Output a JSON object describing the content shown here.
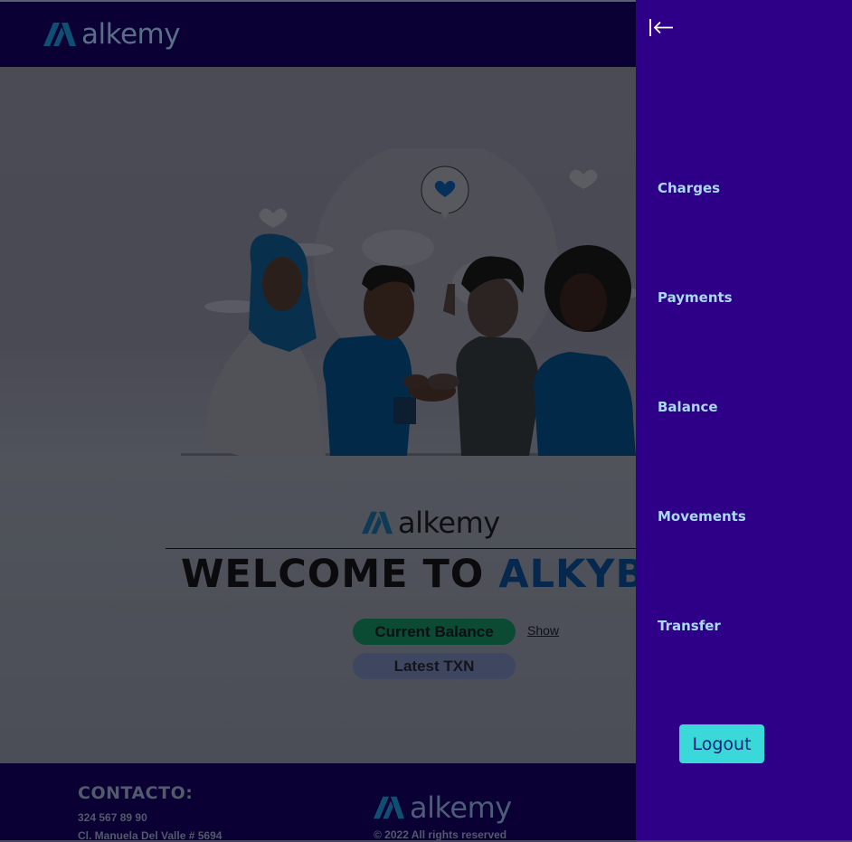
{
  "header": {
    "logo_text": "alkemy"
  },
  "main": {
    "logo_text": "alkemy",
    "welcome_prefix": "WELCOME TO ",
    "welcome_brand": "ALKYBA",
    "current_balance_label": "Current Balance",
    "show_label": "Show",
    "latest_txn_label": "Latest TXN"
  },
  "footer": {
    "contact_title": "CONTACTO:",
    "phone": "324 567 89 90",
    "address": "Cl. Manuela Del Valle # 5694",
    "logo_text": "alkemy",
    "copyright": "© 2022 All rights reserved"
  },
  "sidebar": {
    "items": [
      {
        "label": "Charges"
      },
      {
        "label": "Payments"
      },
      {
        "label": "Balance"
      },
      {
        "label": "Movements"
      },
      {
        "label": "Transfer"
      }
    ],
    "logout_label": "Logout"
  },
  "colors": {
    "header_bg": "#0a0033",
    "sidebar_bg": "#2e0087",
    "nav_text": "#a9d8f2",
    "logout_bg": "#3ad8d8",
    "overlay_page": "#4a4b55"
  },
  "icons": {
    "collapse": "collapse-left-icon",
    "logo_mark": "alkemy-logo-mark-icon",
    "heart": "heart-icon"
  }
}
